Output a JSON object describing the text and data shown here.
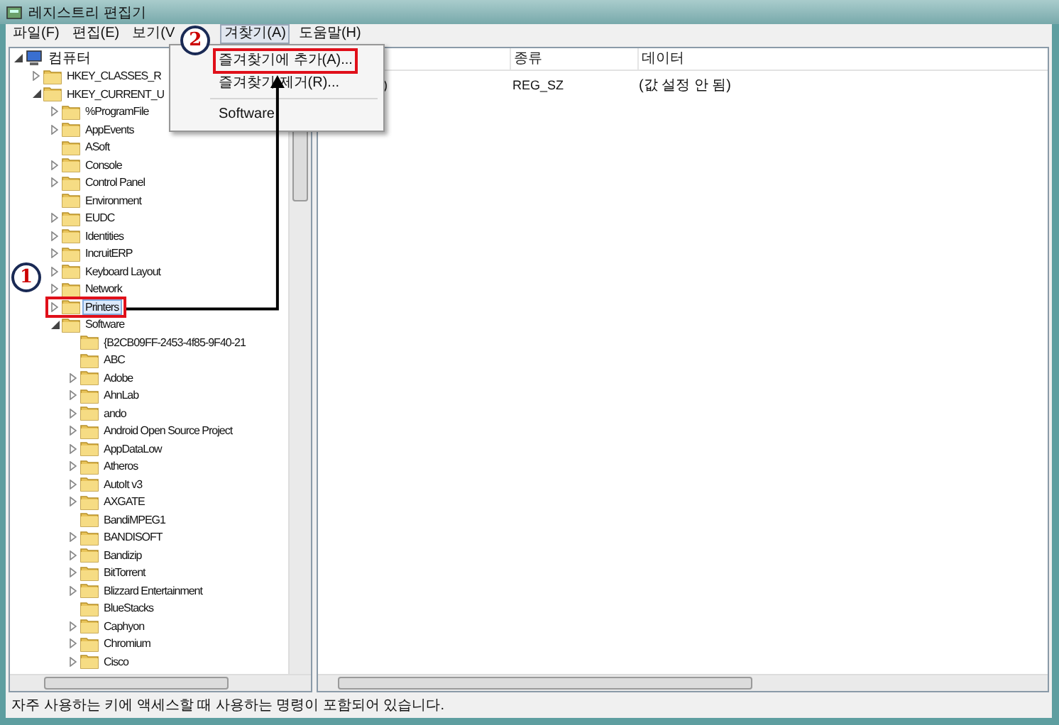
{
  "window": {
    "title": "레지스트리 편집기"
  },
  "menu_bar": [
    {
      "label": "파일(F)",
      "open": false
    },
    {
      "label": "편집(E)",
      "open": false
    },
    {
      "label": "보기(V",
      "open": false
    },
    {
      "label": "겨찾기(A)",
      "open": true
    },
    {
      "label": "도움말(H)",
      "open": false
    }
  ],
  "open_menu": {
    "items": [
      {
        "kind": "item",
        "label": "즐겨찾기에 추가(A)..."
      },
      {
        "kind": "item",
        "label": "즐겨찾기 제거(R)..."
      },
      {
        "kind": "separator"
      },
      {
        "kind": "item",
        "label": "Software"
      }
    ]
  },
  "tree": {
    "label": "컴퓨터",
    "expanded": true,
    "selected": false,
    "children": [
      {
        "label": "HKEY_CLASSES_R",
        "expanded": false,
        "selected": false
      },
      {
        "label": "HKEY_CURRENT_U",
        "expanded": true,
        "selected": false,
        "children": [
          {
            "label": "%ProgramFile",
            "expanded": false,
            "selected": false
          },
          {
            "label": "AppEvents",
            "expanded": false,
            "selected": false
          },
          {
            "label": "ASoft",
            "selected": false
          },
          {
            "label": "Console",
            "expanded": false,
            "selected": false
          },
          {
            "label": "Control Panel",
            "expanded": false,
            "selected": false
          },
          {
            "label": "Environment",
            "selected": false
          },
          {
            "label": "EUDC",
            "expanded": false,
            "selected": false
          },
          {
            "label": "Identities",
            "expanded": false,
            "selected": false
          },
          {
            "label": "IncruitERP",
            "expanded": false,
            "selected": false
          },
          {
            "label": "Keyboard Layout",
            "expanded": false,
            "selected": false
          },
          {
            "label": "Network",
            "expanded": false,
            "selected": false
          },
          {
            "label": "Printers",
            "expanded": false,
            "selected": true
          },
          {
            "label": "Software",
            "expanded": true,
            "selected": false,
            "children": [
              {
                "label": "{B2CB09FF-2453-4f85-9F40-21",
                "selected": false
              },
              {
                "label": "ABC",
                "selected": false
              },
              {
                "label": "Adobe",
                "expanded": false,
                "selected": false
              },
              {
                "label": "AhnLab",
                "expanded": false,
                "selected": false
              },
              {
                "label": "ando",
                "expanded": false,
                "selected": false
              },
              {
                "label": "Android Open Source Project",
                "expanded": false,
                "selected": false
              },
              {
                "label": "AppDataLow",
                "expanded": false,
                "selected": false
              },
              {
                "label": "Atheros",
                "expanded": false,
                "selected": false
              },
              {
                "label": "AutoIt v3",
                "expanded": false,
                "selected": false
              },
              {
                "label": "AXGATE",
                "expanded": false,
                "selected": false
              },
              {
                "label": "BandiMPEG1",
                "selected": false
              },
              {
                "label": "BANDISOFT",
                "expanded": false,
                "selected": false
              },
              {
                "label": "Bandizip",
                "expanded": false,
                "selected": false
              },
              {
                "label": "BitTorrent",
                "expanded": false,
                "selected": false
              },
              {
                "label": "Blizzard Entertainment",
                "expanded": false,
                "selected": false
              },
              {
                "label": "BlueStacks",
                "selected": false
              },
              {
                "label": "Caphyon",
                "expanded": false,
                "selected": false
              },
              {
                "label": "Chromium",
                "expanded": false,
                "selected": false
              },
              {
                "label": "Cisco",
                "expanded": false,
                "selected": false
              }
            ]
          }
        ]
      }
    ]
  },
  "list": {
    "columns": [
      "종류",
      "데이터"
    ],
    "rows": [
      {
        "name": ")",
        "type": "REG_SZ",
        "data": "(값 설정 안 됨)"
      }
    ]
  },
  "status_bar": {
    "text": "자주 사용하는 키에 액세스할 때 사용하는 명령이 포함되어 있습니다."
  },
  "annotations": [
    {
      "kind": "step",
      "number": "1"
    },
    {
      "kind": "step",
      "number": "2"
    }
  ]
}
